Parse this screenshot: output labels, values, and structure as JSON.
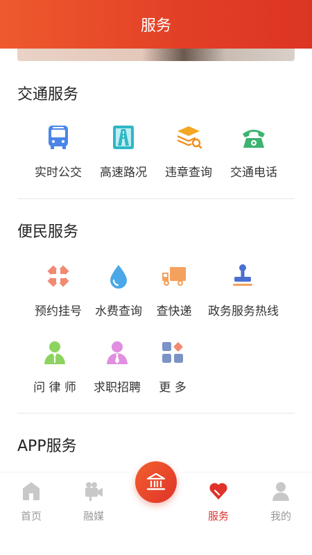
{
  "header": {
    "title": "服务"
  },
  "sections": {
    "traffic": {
      "title": "交通服务",
      "items": [
        {
          "label": "实时公交",
          "icon": "bus-icon"
        },
        {
          "label": "高速路况",
          "icon": "highway-icon"
        },
        {
          "label": "违章查询",
          "icon": "violation-search-icon"
        },
        {
          "label": "交通电话",
          "icon": "telephone-icon"
        }
      ]
    },
    "civil": {
      "title": "便民服务",
      "items": [
        {
          "label": "预约挂号",
          "icon": "hospital-icon"
        },
        {
          "label": "水费查询",
          "icon": "water-drop-icon"
        },
        {
          "label": "查快递",
          "icon": "delivery-truck-icon"
        },
        {
          "label": "政务服务热线",
          "icon": "government-stamp-icon"
        },
        {
          "label": "问 律 师",
          "icon": "lawyer-icon"
        },
        {
          "label": "求职招聘",
          "icon": "job-person-icon"
        },
        {
          "label": "更  多",
          "icon": "more-grid-icon"
        }
      ]
    },
    "app": {
      "title": "APP服务"
    }
  },
  "tabbar": {
    "items": [
      {
        "label": "首页",
        "icon": "home-icon"
      },
      {
        "label": "融媒",
        "icon": "media-camera-icon"
      },
      {
        "label": "",
        "icon": "government-building-icon"
      },
      {
        "label": "服务",
        "icon": "heart-icon",
        "active": true
      },
      {
        "label": "我的",
        "icon": "user-icon"
      }
    ]
  },
  "colors": {
    "header_gradient_start": "#ee5a2e",
    "header_gradient_end": "#dc3524",
    "active_tab": "#e0322a",
    "inactive_tab": "#999999"
  }
}
